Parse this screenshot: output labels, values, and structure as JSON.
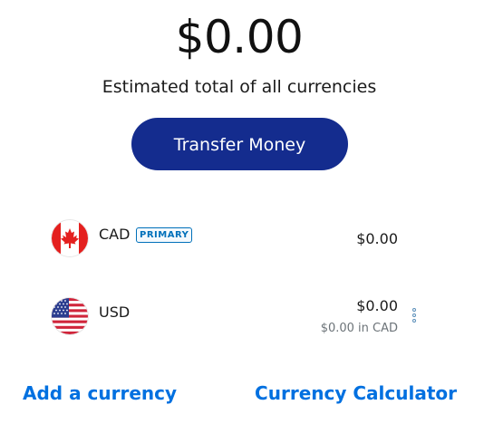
{
  "summary": {
    "total": "$0.00",
    "caption": "Estimated total of all currencies"
  },
  "actions": {
    "transfer_label": "Transfer Money"
  },
  "currencies": [
    {
      "code": "CAD",
      "badge": "PRIMARY",
      "amount": "$0.00",
      "flag_icon": "canada-flag-icon"
    },
    {
      "code": "USD",
      "amount": "$0.00",
      "converted": "$0.00 in CAD",
      "flag_icon": "usa-flag-icon"
    }
  ],
  "footer": {
    "add_currency_label": "Add a currency",
    "calculator_label": "Currency Calculator"
  },
  "colors": {
    "primary_button": "#142c8e",
    "link": "#0070e0",
    "badge": "#0070ba"
  }
}
